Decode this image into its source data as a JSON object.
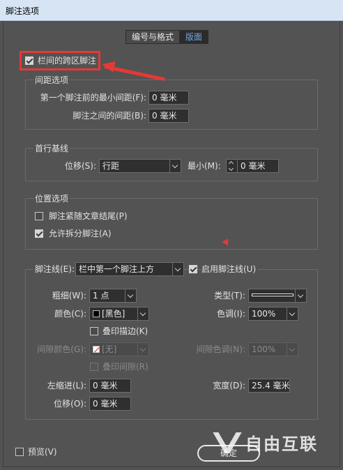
{
  "window": {
    "title": "脚注选项"
  },
  "tabs": [
    {
      "label": "编号与格式",
      "active": false
    },
    {
      "label": "版面",
      "active": true
    }
  ],
  "span_columns": {
    "label": "栏间的跨区脚注",
    "checked": true
  },
  "spacing": {
    "title": "间距选项",
    "min_before_label": "第一个脚注前的最小间距(F):",
    "min_before_value": "0 毫米",
    "between_label": "脚注之间的间距(B):",
    "between_value": "0 毫米"
  },
  "first_baseline": {
    "title": "首行基线",
    "offset_label": "位移(S):",
    "offset_value": "行距",
    "min_label": "最小(M):",
    "min_value": "0 毫米"
  },
  "placement": {
    "title": "位置选项",
    "end_of_story_label": "脚注紧随文章结尾(P)",
    "end_of_story_checked": false,
    "allow_split_label": "允许拆分脚注(A)",
    "allow_split_checked": true
  },
  "rule": {
    "rule_label": "脚注线(E):",
    "rule_value": "栏中第一个脚注上方",
    "enable_label": "启用脚注线(U)",
    "enable_checked": true,
    "weight_label": "粗细(W):",
    "weight_value": "1 点",
    "type_label": "类型(T):",
    "color_label": "颜色(C):",
    "color_value": "[黑色]",
    "tint_label": "色调(I):",
    "tint_value": "100%",
    "overprint_stroke_label": "叠印描边(K)",
    "gap_color_label": "间隙颜色(G):",
    "gap_color_value": "[无]",
    "gap_tint_label": "间隙色调(N):",
    "gap_tint_value": "100%",
    "overprint_gap_label": "叠印间隙(R)",
    "left_indent_label": "左缩进(L):",
    "left_indent_value": "0 毫米",
    "width_label": "宽度(D):",
    "width_value": "25.4 毫米",
    "offset_label": "位移(O):",
    "offset_value": "0 毫米"
  },
  "footer": {
    "preview_label": "预览(V)",
    "ok_label": "确定"
  },
  "watermark": {
    "text": "自由互联"
  },
  "colors": {
    "accent": "#6fa7ea",
    "annotation": "#e53935",
    "background": "#535353"
  }
}
